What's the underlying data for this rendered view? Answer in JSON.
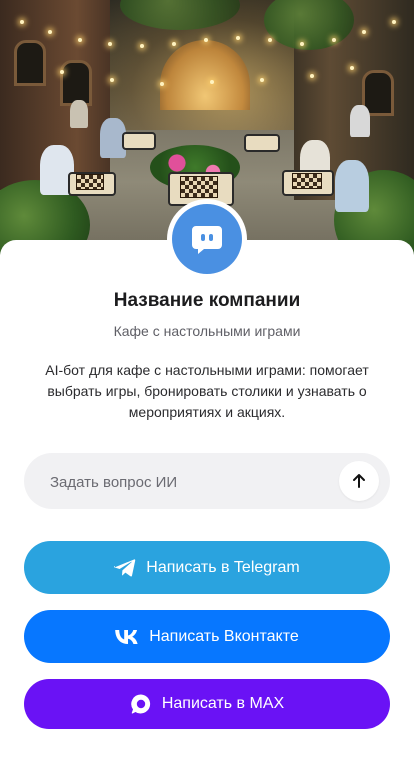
{
  "company": {
    "name": "Название компании",
    "tagline": "Кафе с настольными играми",
    "description": "AI-бот для кафе с настольными играми: помогает выбрать игры, бронировать столики и узнавать о мероприятиях и акциях."
  },
  "ask": {
    "placeholder": "Задать вопрос ИИ",
    "value": "",
    "send_icon": "arrow-up-icon"
  },
  "buttons": [
    {
      "label": "Написать в Telegram",
      "icon": "telegram-icon",
      "color": "#2aa3df"
    },
    {
      "label": "Написать Вконтакте",
      "icon": "vk-icon",
      "color": "#0777ff"
    },
    {
      "label": "Написать в MAX",
      "icon": "max-icon",
      "color": "#6a12f5"
    }
  ],
  "colors": {
    "avatar": "#4a90e2",
    "ask_background": "#f1f1f3"
  },
  "avatar": {
    "icon": "chat-bot-icon"
  },
  "hero": {
    "image": "Chess players at tables in a lantern-lit café courtyard"
  }
}
